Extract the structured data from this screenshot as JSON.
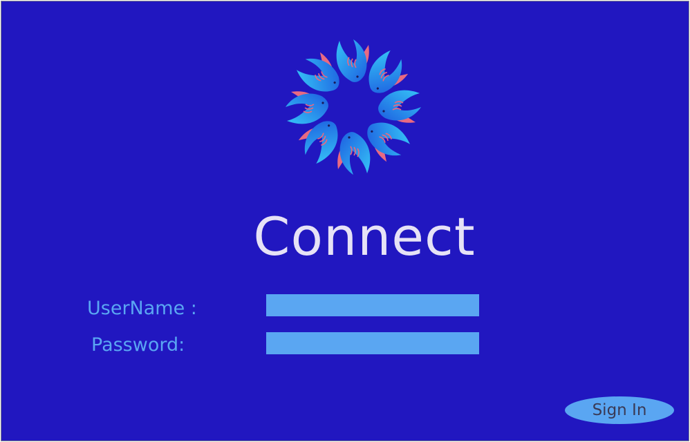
{
  "app": {
    "title": "Connect"
  },
  "logo": {
    "icon": "bird-rosette-logo-icon",
    "colors": {
      "bird_light": "#31b8f4",
      "bird_dark": "#1e63dd",
      "accent": "#e86a82"
    }
  },
  "form": {
    "username_label": "UserName :",
    "username_value": "",
    "password_label": "Password:",
    "password_value": "",
    "signin_label": "Sign In"
  },
  "colors": {
    "background": "#2117c0",
    "field": "#5aa6f2",
    "title_text": "#e6e2f6",
    "label_text": "#5aa6f2"
  }
}
